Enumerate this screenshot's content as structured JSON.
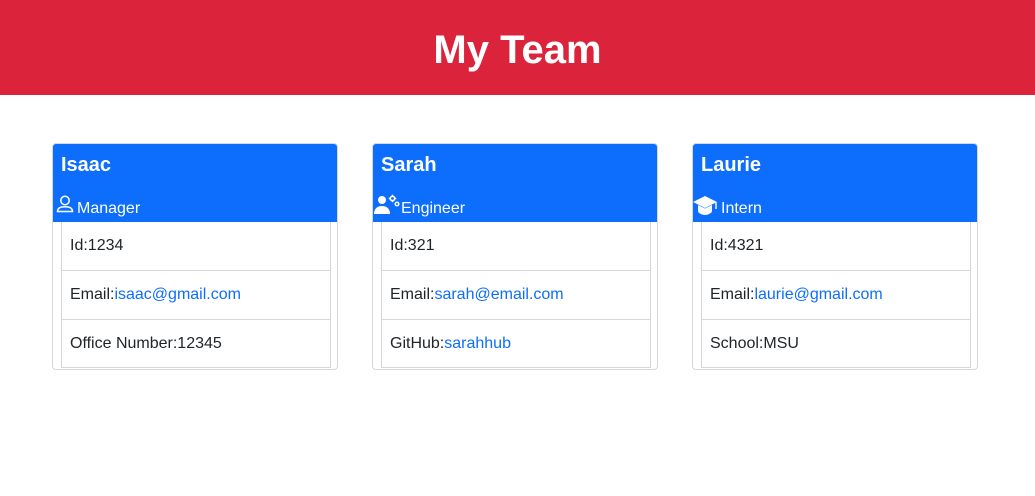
{
  "header": {
    "title": "My Team"
  },
  "cards": [
    {
      "name": "Isaac",
      "role": "Manager",
      "icon": "person-icon",
      "id_label": "Id: ",
      "id": "1234",
      "email_label": "Email: ",
      "email": "isaac@gmail.com",
      "extra_label": "Office Number: ",
      "extra_value": "12345"
    },
    {
      "name": "Sarah",
      "role": "Engineer",
      "icon": "engineer-icon",
      "id_label": "Id: ",
      "id": "321",
      "email_label": "Email: ",
      "email": "sarah@email.com",
      "extra_label": "GitHub: ",
      "extra_value": "sarahhub"
    },
    {
      "name": "Laurie",
      "role": "Intern",
      "icon": "graduation-cap-icon",
      "id_label": "Id: ",
      "id": "4321",
      "email_label": "Email: ",
      "email": "laurie@gmail.com",
      "extra_label": "School: ",
      "extra_value": "MSU"
    }
  ],
  "colors": {
    "header_bg": "#dc233c",
    "card_head_bg": "#0d6efd",
    "link": "#0d6efd"
  }
}
